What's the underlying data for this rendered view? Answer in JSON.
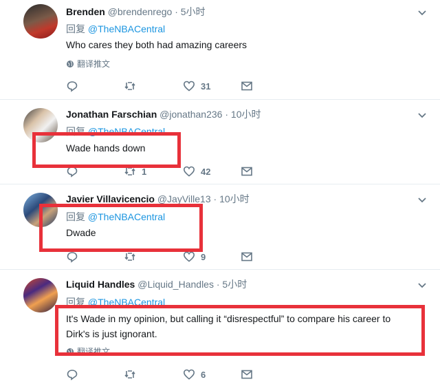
{
  "tweets": [
    {
      "name": "Brenden",
      "handle": "@brendenrego",
      "dot": "·",
      "time": "5小时",
      "reply_label": "回复",
      "mention": "@TheNBACentral",
      "text": "Who cares they both had amazing careers",
      "translate": "翻译推文",
      "retweets": "",
      "likes": "31"
    },
    {
      "name": "Jonathan Farschian",
      "handle": "@jonathan236",
      "dot": "·",
      "time": "10小时",
      "reply_label": "回复",
      "mention": "@TheNBACentral",
      "text": "Wade hands down",
      "retweets": "1",
      "likes": "42"
    },
    {
      "name": "Javier Villavicencio",
      "handle": "@JayVille13",
      "dot": "·",
      "time": "10小时",
      "reply_label": "回复",
      "mention": "@TheNBACentral",
      "text": "Dwade",
      "retweets": "",
      "likes": "9"
    },
    {
      "name": "Liquid Handles",
      "handle": "@Liquid_Handles",
      "dot": "·",
      "time": "5小时",
      "reply_label": "回复",
      "mention": "@TheNBACentral",
      "text_line1": "It's Wade in my opinion, but calling it “disrespectful” to compare his career to",
      "text_line2": "Dirk's is just ignorant.",
      "translate": "翻译推文",
      "retweets": "",
      "likes": "6"
    }
  ],
  "colors": {
    "link": "#1b95e0",
    "muted": "#657786",
    "highlight_box": "#e8313a"
  }
}
